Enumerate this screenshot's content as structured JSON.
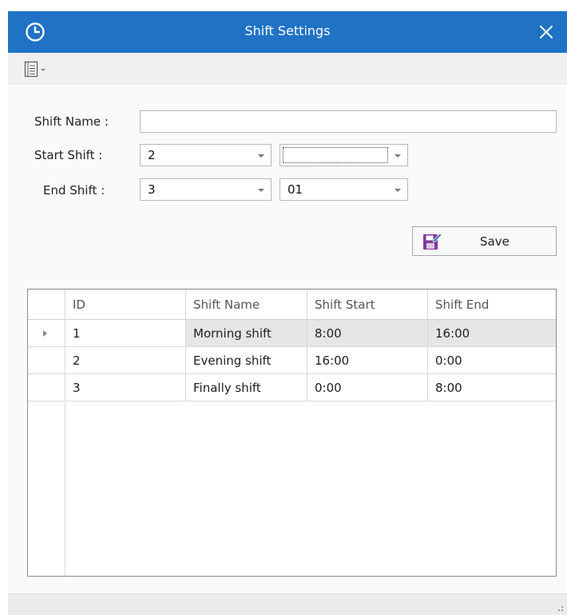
{
  "window": {
    "title": "Shift Settings",
    "accent_color": "#1f72c4",
    "icons": {
      "app": "clock-icon",
      "close": "close-icon",
      "menu": "list-menu-icon",
      "save": "floppy-save-icon"
    }
  },
  "form": {
    "shift_name_label": "Shift Name :",
    "shift_name_value": "",
    "start_shift_label": "Start Shift :",
    "start_hour_value": "2",
    "start_minute_value": "",
    "end_shift_label": "End Shift :",
    "end_hour_value": "3",
    "end_minute_value": "01",
    "save_label": "Save"
  },
  "table": {
    "columns": [
      "ID",
      "Shift Name",
      "Shift Start",
      "Shift End"
    ],
    "rows": [
      {
        "id": "1",
        "name": "Morning shift",
        "start": "8:00",
        "end": "16:00"
      },
      {
        "id": "2",
        "name": "Evening shift",
        "start": "16:00",
        "end": "0:00"
      },
      {
        "id": "3",
        "name": "Finally shift",
        "start": "0:00",
        "end": "8:00"
      }
    ]
  }
}
